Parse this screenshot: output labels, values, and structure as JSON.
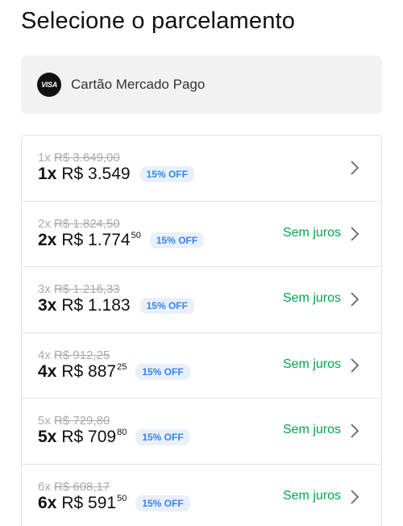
{
  "header": {
    "title": "Selecione o parcelamento"
  },
  "card": {
    "brand": "VISA",
    "label": "Cartão Mercado Pago"
  },
  "options": [
    {
      "original_count": "1x",
      "original_price": "R$ 3.649,00",
      "count": "1x",
      "price": "R$ 3.549",
      "cents": "",
      "discount": "15% OFF",
      "interest": ""
    },
    {
      "original_count": "2x",
      "original_price": "R$ 1.824,50",
      "count": "2x",
      "price": "R$ 1.774",
      "cents": "50",
      "discount": "15% OFF",
      "interest": "Sem juros"
    },
    {
      "original_count": "3x",
      "original_price": "R$ 1.216,33",
      "count": "3x",
      "price": "R$ 1.183",
      "cents": "",
      "discount": "15% OFF",
      "interest": "Sem juros"
    },
    {
      "original_count": "4x",
      "original_price": "R$ 912,25",
      "count": "4x",
      "price": "R$ 887",
      "cents": "25",
      "discount": "15% OFF",
      "interest": "Sem juros"
    },
    {
      "original_count": "5x",
      "original_price": "R$ 729,80",
      "count": "5x",
      "price": "R$ 709",
      "cents": "80",
      "discount": "15% OFF",
      "interest": "Sem juros"
    },
    {
      "original_count": "6x",
      "original_price": "R$ 608,17",
      "count": "6x",
      "price": "R$ 591",
      "cents": "50",
      "discount": "15% OFF",
      "interest": "Sem juros"
    }
  ],
  "colors": {
    "accent_blue": "#3483fa",
    "badge_bg": "#e9f0fb",
    "green": "#00a650"
  }
}
